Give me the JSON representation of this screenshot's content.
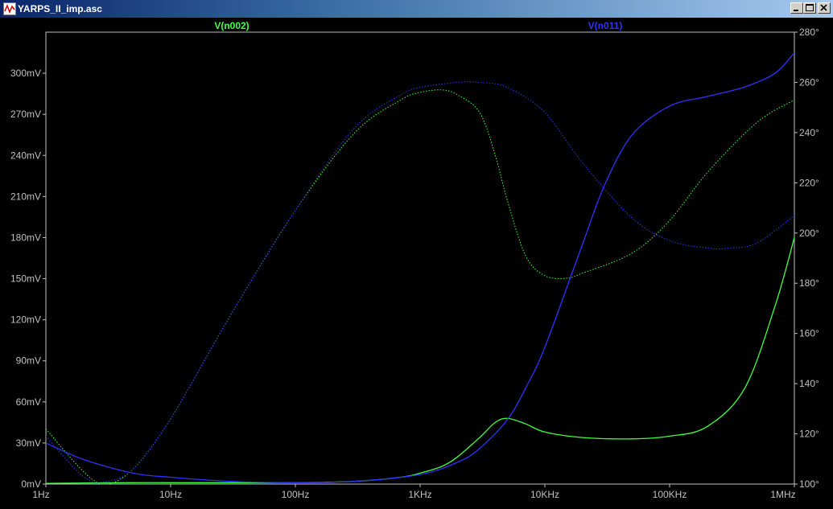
{
  "window": {
    "title": "YARPS_II_imp.asc",
    "icon": "ltspice-waveform-icon",
    "buttons": {
      "minimize": "minimize-icon",
      "maximize": "maximize-icon",
      "close": "close-icon"
    }
  },
  "colors": {
    "plot_background": "#000000",
    "axis": "#c0c0c0",
    "series_green": "#40ff40",
    "series_blue": "#3030ff"
  },
  "chart_data": {
    "type": "line",
    "title": "",
    "xlabel": "",
    "ylabel": "",
    "x_scale": "log",
    "xlim": [
      1,
      1000000
    ],
    "ylim": [
      0,
      330
    ],
    "y2lim": [
      100,
      280
    ],
    "grid": false,
    "legend": "top",
    "x_ticks": [
      {
        "value": 1,
        "label": "1Hz"
      },
      {
        "value": 10,
        "label": "10Hz"
      },
      {
        "value": 100,
        "label": "100Hz"
      },
      {
        "value": 1000,
        "label": "1KHz"
      },
      {
        "value": 10000,
        "label": "10KHz"
      },
      {
        "value": 100000,
        "label": "100KHz"
      },
      {
        "value": 1000000,
        "label": "1MHz"
      }
    ],
    "y_ticks": [
      {
        "value": 0,
        "label": "0mV"
      },
      {
        "value": 30,
        "label": "30mV"
      },
      {
        "value": 60,
        "label": "60mV"
      },
      {
        "value": 90,
        "label": "90mV"
      },
      {
        "value": 120,
        "label": "120mV"
      },
      {
        "value": 150,
        "label": "150mV"
      },
      {
        "value": 180,
        "label": "180mV"
      },
      {
        "value": 210,
        "label": "210mV"
      },
      {
        "value": 240,
        "label": "240mV"
      },
      {
        "value": 270,
        "label": "270mV"
      },
      {
        "value": 300,
        "label": "300mV"
      }
    ],
    "y2_ticks": [
      {
        "value": 100,
        "label": "100°"
      },
      {
        "value": 120,
        "label": "120°"
      },
      {
        "value": 140,
        "label": "140°"
      },
      {
        "value": 160,
        "label": "160°"
      },
      {
        "value": 180,
        "label": "180°"
      },
      {
        "value": 200,
        "label": "200°"
      },
      {
        "value": 220,
        "label": "220°"
      },
      {
        "value": 240,
        "label": "240°"
      },
      {
        "value": 260,
        "label": "260°"
      },
      {
        "value": 280,
        "label": "280°"
      }
    ],
    "series": [
      {
        "name": "V(n002)",
        "legend_position": "left",
        "color": "#40ff40",
        "magnitude": {
          "axis": "left",
          "style": "solid",
          "x": [
            1,
            2,
            5,
            10,
            30,
            100,
            300,
            700,
            1000,
            1500,
            2000,
            3000,
            4000,
            5000,
            7000,
            10000,
            20000,
            50000,
            100000,
            200000,
            400000,
            700000,
            1000000
          ],
          "y": [
            0.5,
            0.8,
            1,
            1,
            1,
            1,
            2,
            5,
            8,
            13,
            20,
            34,
            45,
            48,
            44,
            38,
            34,
            33,
            35,
            42,
            70,
            130,
            180
          ]
        },
        "phase": {
          "axis": "right",
          "style": "dotted",
          "x": [
            1,
            2,
            3,
            5,
            10,
            30,
            100,
            300,
            700,
            1000,
            1500,
            2000,
            3000,
            4000,
            5000,
            7000,
            10000,
            15000,
            20000,
            50000,
            100000,
            200000,
            500000,
            1000000
          ],
          "y": [
            122,
            105,
            100,
            106,
            126,
            167,
            209,
            240,
            253,
            256,
            257,
            255,
            248,
            231,
            213,
            191,
            183,
            182,
            184,
            192,
            205,
            224,
            244,
            253
          ]
        }
      },
      {
        "name": "V(n011)",
        "legend_position": "right",
        "color": "#3030ff",
        "magnitude": {
          "axis": "left",
          "style": "solid",
          "x": [
            1,
            2,
            5,
            10,
            30,
            100,
            300,
            1000,
            2000,
            3000,
            5000,
            7000,
            10000,
            20000,
            30000,
            50000,
            100000,
            200000,
            400000,
            700000,
            1000000
          ],
          "y": [
            30,
            18,
            8,
            5,
            2,
            1,
            2,
            7,
            16,
            26,
            47,
            70,
            100,
            175,
            218,
            255,
            276,
            283,
            290,
            300,
            315
          ]
        },
        "phase": {
          "axis": "right",
          "style": "dotted",
          "x": [
            1,
            2,
            3,
            5,
            10,
            30,
            100,
            300,
            700,
            1000,
            2000,
            3000,
            5000,
            10000,
            20000,
            50000,
            100000,
            200000,
            300000,
            500000,
            1000000
          ],
          "y": [
            119,
            103,
            101,
            106,
            126,
            167,
            209,
            242,
            255,
            258,
            260,
            260,
            258,
            248,
            228,
            206,
            197,
            194,
            194,
            196,
            207
          ]
        }
      }
    ]
  }
}
